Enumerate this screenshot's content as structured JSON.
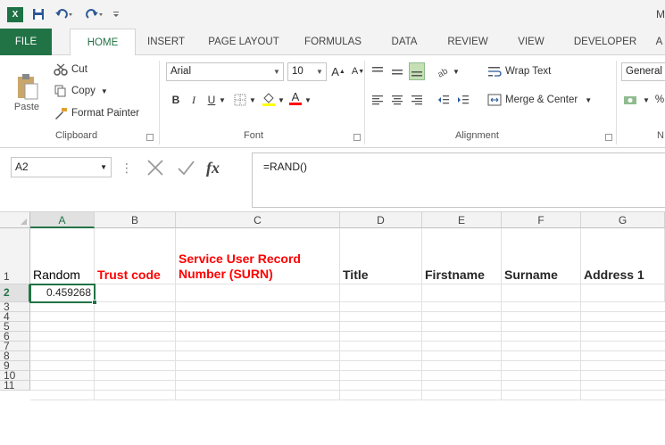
{
  "app": {
    "logo": "X",
    "title_partial": "M"
  },
  "qat": {
    "save_icon": "save-icon",
    "undo_icon": "undo-icon",
    "redo_icon": "redo-icon",
    "customize_icon": "customize-icon"
  },
  "tabs": [
    "FILE",
    "HOME",
    "INSERT",
    "PAGE LAYOUT",
    "FORMULAS",
    "DATA",
    "REVIEW",
    "VIEW",
    "DEVELOPER",
    "A"
  ],
  "active_tab": "HOME",
  "ribbon": {
    "clipboard": {
      "paste": "Paste",
      "cut": "Cut",
      "copy": "Copy",
      "format_painter": "Format Painter",
      "label": "Clipboard"
    },
    "font": {
      "font_name": "Arial",
      "font_size": "10",
      "bold": "B",
      "italic": "I",
      "underline": "U",
      "grow": "A",
      "shrink": "A",
      "font_color": "A",
      "label": "Font"
    },
    "alignment": {
      "wrap_text": "Wrap Text",
      "merge_center": "Merge & Center",
      "label": "Alignment"
    },
    "number": {
      "format": "General",
      "percent": "%",
      "label": "N"
    }
  },
  "formula_bar": {
    "name_box": "A2",
    "fx": "fx",
    "formula": "=RAND()"
  },
  "grid": {
    "columns": [
      "A",
      "B",
      "C",
      "D",
      "E",
      "F",
      "G"
    ],
    "rows": [
      "1",
      "2",
      "3",
      "4",
      "5",
      "6",
      "7",
      "8",
      "9",
      "10",
      "11"
    ],
    "header_row": {
      "a": "Random",
      "b": "Trust code",
      "c": "Service User Record Number (SURN)",
      "d": "Title",
      "e": "Firstname",
      "f": "Surname",
      "g": "Address 1"
    },
    "a2": "0.459268"
  },
  "colors": {
    "excel_green": "#217346",
    "header_red": "#ff0000"
  }
}
